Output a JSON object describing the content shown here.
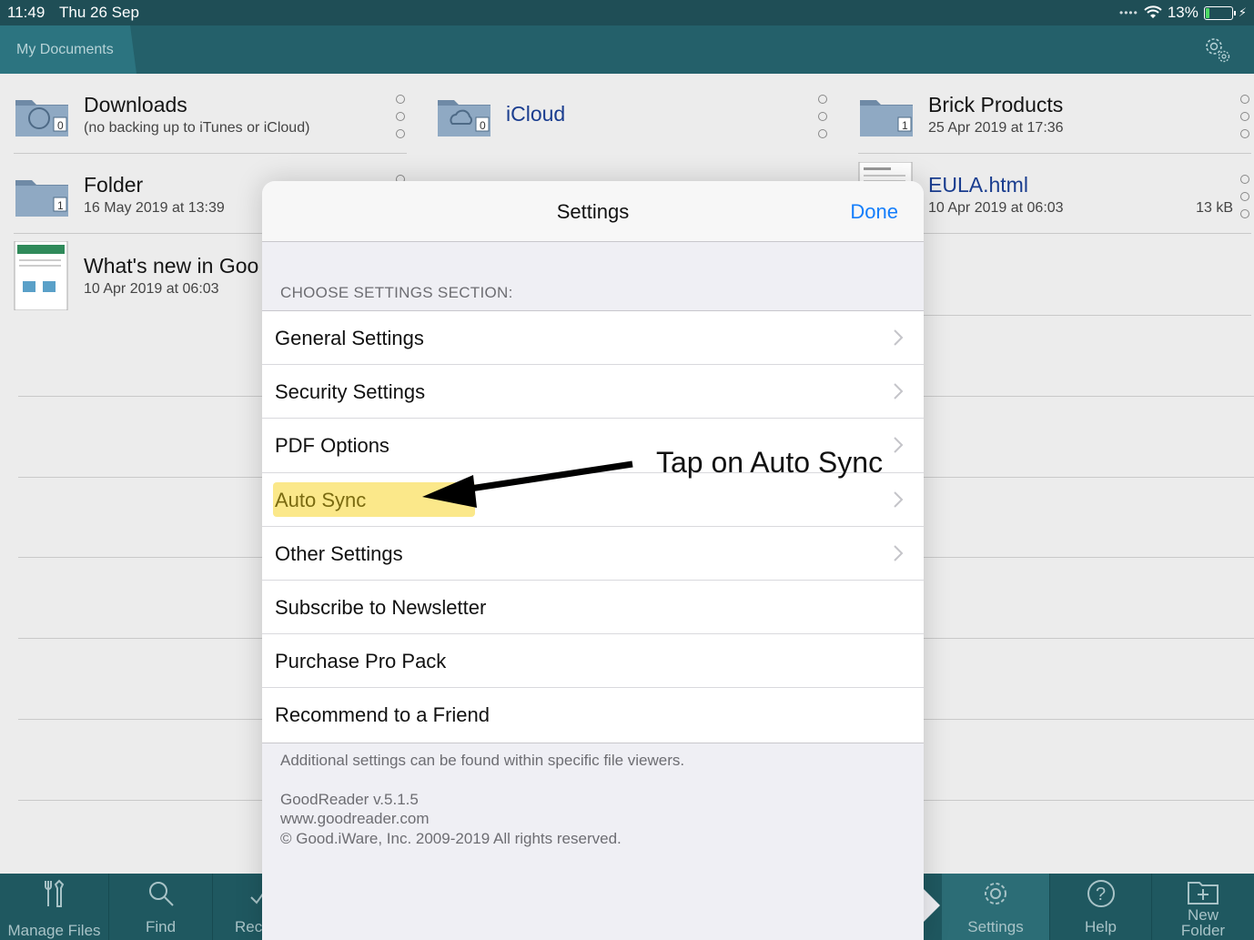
{
  "status": {
    "time": "11:49",
    "date": "Thu 26 Sep",
    "battery": "13%",
    "battery_level": 0.13,
    "battery_color": "#4cd964"
  },
  "nav": {
    "tab_label": "My Documents",
    "settings_icon": "gear-icon"
  },
  "files": [
    {
      "name": "Downloads",
      "sub": "(no backing up to iTunes or iCloud)",
      "icon": "folder-globe-icon",
      "badge": "0"
    },
    {
      "name": "iCloud",
      "sub": "",
      "icon": "folder-cloud-icon",
      "badge": "0"
    },
    {
      "name": "Brick Products",
      "sub": "25 Apr 2019 at 17:36",
      "icon": "folder-icon",
      "badge": "1"
    },
    {
      "name": "Folder",
      "sub": "16 May 2019 at 13:39",
      "icon": "folder-icon",
      "badge": "1"
    },
    {
      "name": "EULA.html",
      "sub": "10 Apr 2019 at 06:03",
      "size": "13 kB",
      "icon": "document-icon"
    },
    {
      "name": "What's new in Goo",
      "sub": "10 Apr 2019 at 06:03",
      "icon": "document-icon"
    }
  ],
  "modal": {
    "title": "Settings",
    "done": "Done",
    "section_header": "CHOOSE SETTINGS SECTION:",
    "rows": [
      {
        "label": "General Settings",
        "chevron": true
      },
      {
        "label": "Security Settings",
        "chevron": true
      },
      {
        "label": "PDF Options",
        "chevron": true
      },
      {
        "label": "Auto Sync",
        "chevron": true,
        "highlighted": true
      },
      {
        "label": "Other Settings",
        "chevron": true
      },
      {
        "label": "Subscribe to Newsletter",
        "chevron": false
      },
      {
        "label": "Purchase Pro Pack",
        "chevron": false
      },
      {
        "label": "Recommend to a Friend",
        "chevron": false
      }
    ],
    "footer_note": "Additional settings can be found within specific file viewers.",
    "version": "GoodReader v.5.1.5",
    "website": "www.goodreader.com",
    "copyright": "© Good.iWare, Inc. 2009-2019 All rights reserved."
  },
  "annotation": {
    "text": "Tap on Auto Sync",
    "highlight_color": "#fbe88a"
  },
  "toolbar": {
    "items": [
      {
        "label": "Manage Files",
        "icon": "tools-icon"
      },
      {
        "label": "Find",
        "icon": "magnifier-icon"
      },
      {
        "label": "Rec",
        "icon": "checkmark-icon"
      },
      {
        "label": "Settings",
        "icon": "gear-icon",
        "active": true
      },
      {
        "label": "Help",
        "icon": "question-icon"
      },
      {
        "label": "New Folder",
        "icon": "new-folder-icon"
      }
    ]
  },
  "colors": {
    "bar_dark": "#1f4e56",
    "nav": "#24606a",
    "toolbar": "#1f5860",
    "link_blue": "#147efb"
  }
}
